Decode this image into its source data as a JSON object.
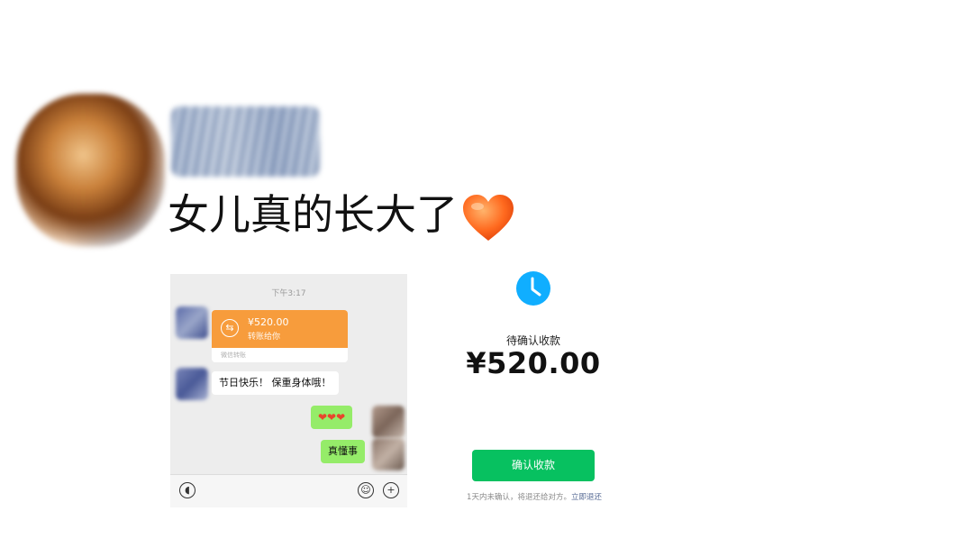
{
  "post": {
    "text": "女儿真的长大了",
    "emoji": "heart-icon"
  },
  "chat": {
    "time": "下午3:17",
    "transfer": {
      "amount": "¥520.00",
      "subtitle": "转账给你",
      "footer": "微信转账"
    },
    "message_1": "节日快乐！ 保重身体哦！",
    "message_2": "❤❤❤",
    "message_3": "真懂事"
  },
  "receive": {
    "status": "待确认收款",
    "amount": "¥520.00",
    "confirm_button": "确认收款",
    "note_text": "1天内未确认，将退还给对方。",
    "note_link": "立即退还"
  },
  "colors": {
    "transfer_orange": "#f79c3c",
    "bubble_green": "#95ec69",
    "confirm_green": "#07c160",
    "clock_blue": "#10aeff",
    "link_blue": "#576b95"
  }
}
